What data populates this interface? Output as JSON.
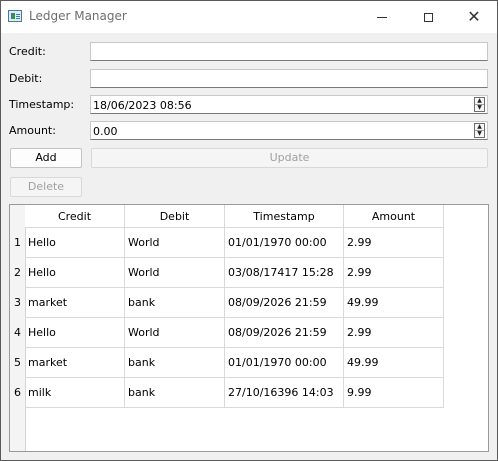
{
  "window": {
    "title": "Ledger Manager"
  },
  "form": {
    "credit_label": "Credit:",
    "credit_value": "",
    "debit_label": "Debit:",
    "debit_value": "",
    "timestamp_label": "Timestamp:",
    "timestamp_value": "18/06/2023 08:56",
    "amount_label": "Amount:",
    "amount_value": "0.00"
  },
  "buttons": {
    "add": "Add",
    "update": "Update",
    "delete": "Delete"
  },
  "table": {
    "columns": [
      "Credit",
      "Debit",
      "Timestamp",
      "Amount"
    ],
    "rows": [
      {
        "num": "1",
        "credit": "Hello",
        "debit": "World",
        "timestamp": "01/01/1970 00:00",
        "amount": "2.99"
      },
      {
        "num": "2",
        "credit": "Hello",
        "debit": "World",
        "timestamp": "03/08/17417 15:28",
        "amount": "2.99"
      },
      {
        "num": "3",
        "credit": "market",
        "debit": "bank",
        "timestamp": "08/09/2026 21:59",
        "amount": "49.99"
      },
      {
        "num": "4",
        "credit": "Hello",
        "debit": "World",
        "timestamp": "08/09/2026 21:59",
        "amount": "2.99"
      },
      {
        "num": "5",
        "credit": "market",
        "debit": "bank",
        "timestamp": "01/01/1970 00:00",
        "amount": "49.99"
      },
      {
        "num": "6",
        "credit": "milk",
        "debit": "bank",
        "timestamp": "27/10/16396 14:03",
        "amount": "9.99"
      }
    ]
  }
}
